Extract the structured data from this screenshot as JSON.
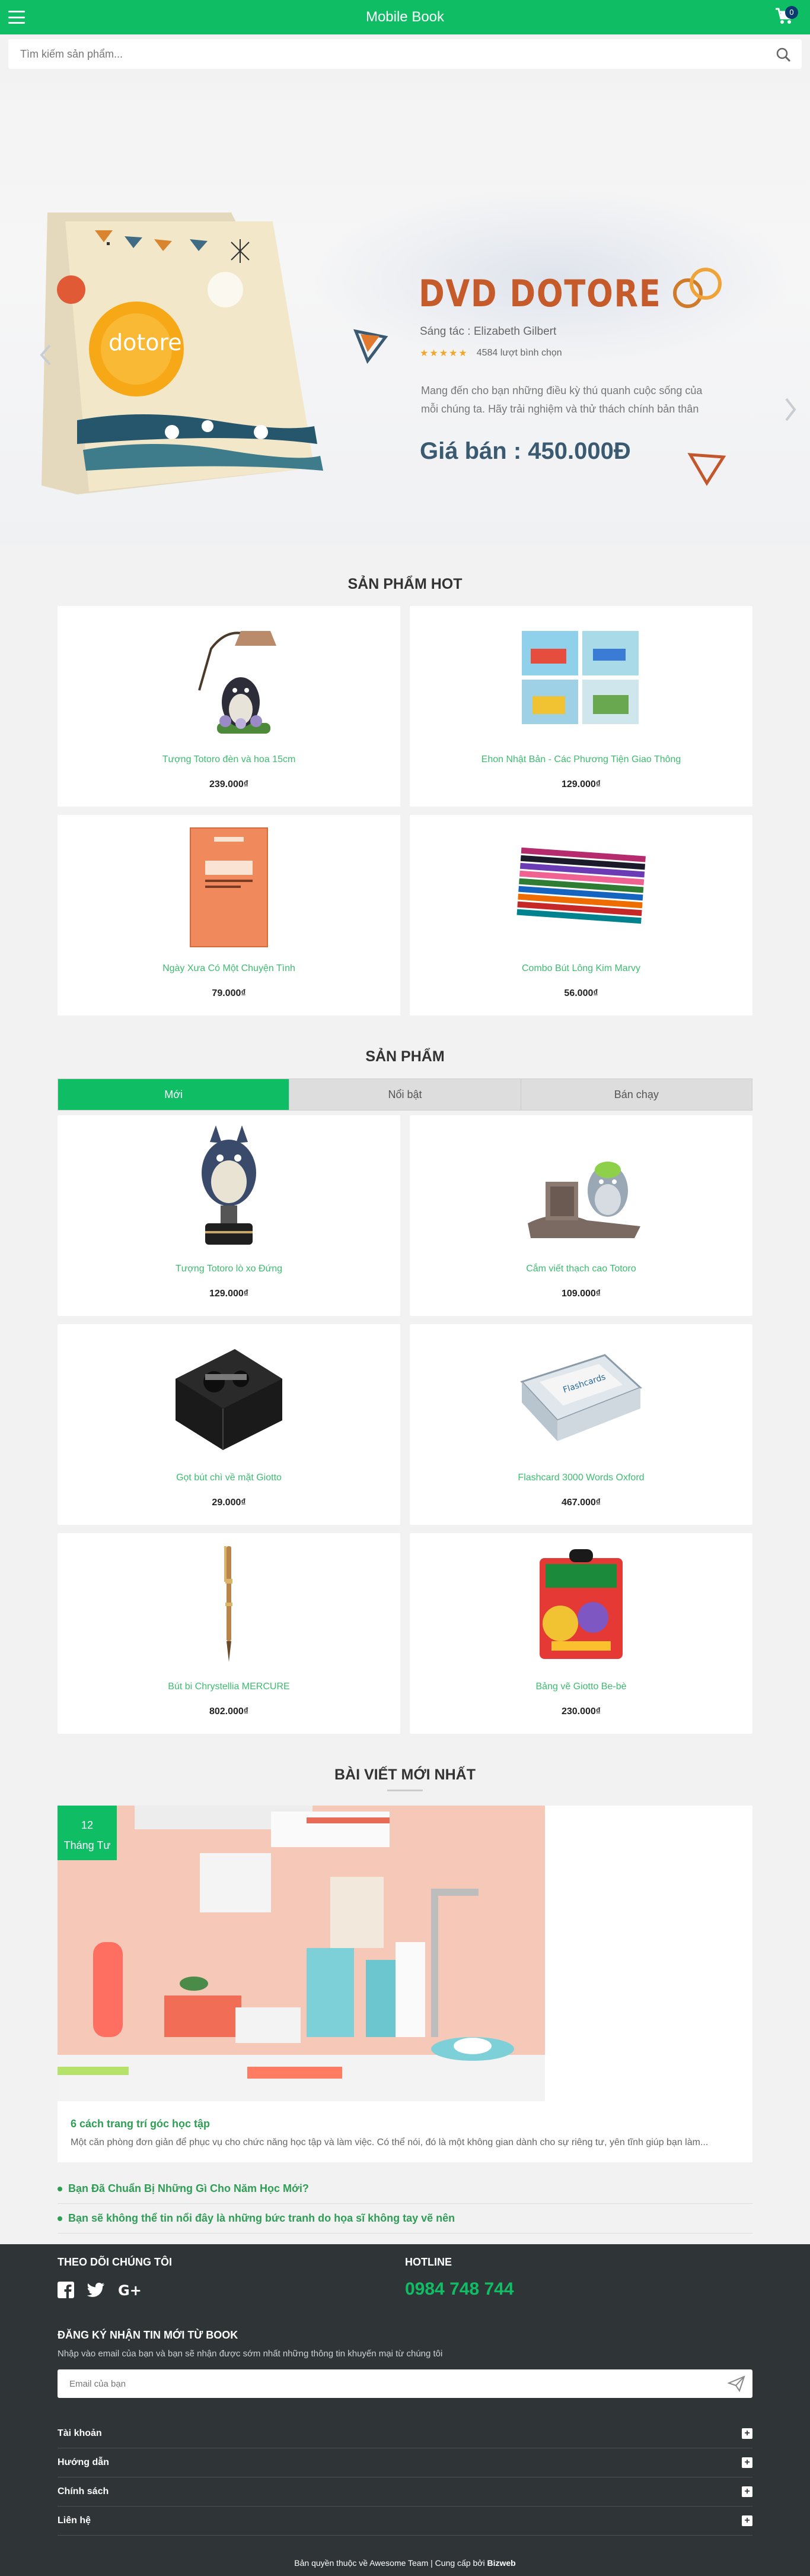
{
  "header": {
    "title": "Mobile Book",
    "cart_count": "0",
    "search_placeholder": "Tìm kiếm sản phẩm..."
  },
  "hero": {
    "headline": "DVD DOTORE",
    "book_cover_text": "dotore",
    "author": "Sáng tác : Elizabeth Gilbert",
    "rating_count": "4584 lượt bình chọn",
    "stars": "★★★★★",
    "description": "Mang đến cho bạn những điều kỳ thú quanh cuộc sống của mỗi chúng ta. Hãy trải nghiệm và thử thách chính bản thân",
    "price": "Giá bán : 450.000Đ"
  },
  "hot_section": {
    "title": "SẢN PHẨM HOT",
    "products": [
      {
        "name": "Tượng Totoro đèn và hoa 15cm",
        "price": "239.000₫",
        "icon": "totoro-lamp"
      },
      {
        "name": "Ehon Nhật Bản - Các Phương Tiện Giao Thông",
        "price": "129.000₫",
        "icon": "book-set"
      },
      {
        "name": "Ngày Xưa Có Một Chuyện Tình",
        "price": "79.000₫",
        "icon": "book-orange"
      },
      {
        "name": "Combo Bút Lông Kim Marvy",
        "price": "56.000₫",
        "icon": "pens"
      }
    ]
  },
  "product_section": {
    "title": "SẢN PHẨM",
    "tabs": [
      "Mới",
      "Nổi bật",
      "Bán chạy"
    ],
    "products": [
      {
        "name": "Tượng Totoro lò xo Đứng",
        "price": "129.000₫",
        "icon": "totoro-spring"
      },
      {
        "name": "Cắm viết thạch cao Totoro",
        "price": "109.000₫",
        "icon": "totoro-penholder"
      },
      {
        "name": "Gọt bút chì về mặt Giotto",
        "price": "29.000₫",
        "icon": "sharpener"
      },
      {
        "name": "Flashcard 3000 Words Oxford",
        "price": "467.000₫",
        "icon": "flashcard"
      },
      {
        "name": "Bút bi Chrystellia MERCURE",
        "price": "802.000₫",
        "icon": "pen"
      },
      {
        "name": "Bảng vẽ Giotto Be-bè",
        "price": "230.000₫",
        "icon": "drawing-board"
      }
    ]
  },
  "blog_section": {
    "title": "BÀI VIẾT MỚI NHẤT",
    "featured": {
      "day": "12",
      "month": "Tháng Tư",
      "title": "6 cách trang trí góc học tập",
      "excerpt": "Một căn phòng đơn giản để phục vụ cho chức năng học tập và làm việc. Có thể nói, đó là một không gian dành cho sự riêng tư, yên tĩnh giúp bạn làm..."
    },
    "list": [
      "Bạn Đã Chuẩn Bị Những Gì Cho Năm Học Mới?",
      "Bạn sẽ không thể tin nổi đây là những bức tranh do họa sĩ không tay vẽ nên"
    ]
  },
  "footer": {
    "follow_title": "THEO DÕI CHÚNG TÔI",
    "hotline_title": "HOTLINE",
    "hotline": "0984 748 744",
    "newsletter_title": "ĐĂNG KÝ NHẬN TIN MỚI TỪ BOOK",
    "newsletter_desc": "Nhập vào email của bạn và bạn sẽ nhận được sớm nhất những thông tin khuyến mại từ chúng tôi",
    "email_placeholder": "Email của bạn",
    "accordion": [
      "Tài khoản",
      "Hướng dẫn",
      "Chính sách",
      "Liên hệ"
    ],
    "copyright_prefix": "Bản quyền thuộc về Awesome Team | Cung cấp bởi ",
    "copyright_brand": "Bizweb"
  },
  "colors": {
    "primary": "#0fbe64",
    "footer_bg": "#2f3537",
    "link_green": "#3cbc6e",
    "hero_headline": "#c55a2a"
  }
}
